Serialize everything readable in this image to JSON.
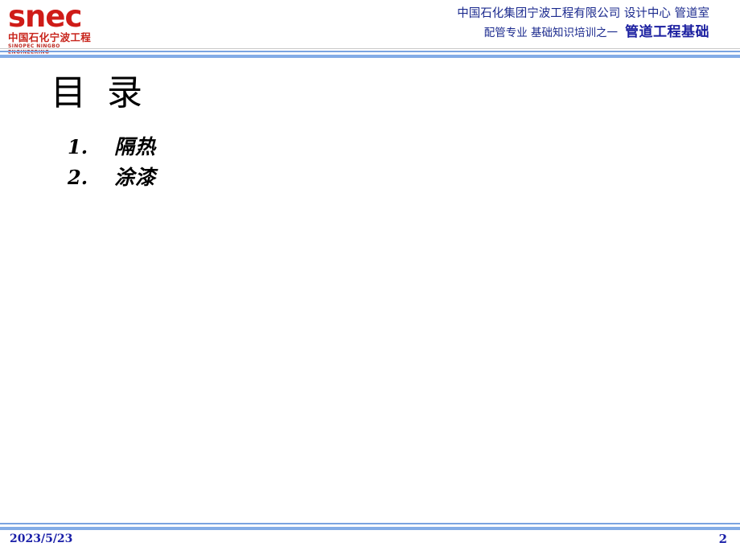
{
  "slide": {
    "page_number": "2",
    "date": "2023/5/23",
    "background_color": "#ffffff"
  },
  "header": {
    "logo": {
      "wordmark": "snec",
      "chinese_name": "中国石化宁波工程",
      "english_name": "SINOPEC NINGBO ENGINEERING",
      "color": "#CF1C18"
    },
    "line1": "中国石化集团宁波工程有限公司  设计中心 管道室",
    "line2_prefix": "配管专业 基础知识培训之一",
    "line2_emphasis": "管道工程基础",
    "text_color": "#1B2A8E",
    "rule_color": "#7aa3e0"
  },
  "body": {
    "title": "目 录",
    "items": [
      {
        "number": "1.",
        "label": "隔热"
      },
      {
        "number": "2.",
        "label": "涂漆"
      }
    ]
  }
}
